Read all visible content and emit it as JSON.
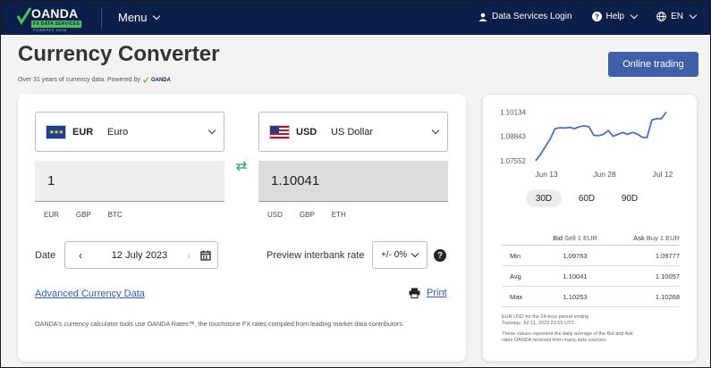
{
  "nav": {
    "brand": "OANDA",
    "brand_tag": "FX DATA SERVICES",
    "brand_sub": "POWERED DATA",
    "menu_label": "Menu",
    "login_label": "Data Services Login",
    "help_label": "Help",
    "lang_label": "EN"
  },
  "header": {
    "title": "Currency Converter",
    "subtitle": "Over 31 years of currency data. Powered by",
    "powered_brand": "OANDA",
    "cta": "Online trading"
  },
  "converter": {
    "from": {
      "code": "EUR",
      "name": "Euro",
      "amount": "1"
    },
    "to": {
      "code": "USD",
      "name": "US Dollar",
      "amount": "1.10041"
    },
    "from_quick": [
      "EUR",
      "GBP",
      "BTC"
    ],
    "to_quick": [
      "USD",
      "GBP",
      "ETH"
    ],
    "date_label": "Date",
    "date_value": "12 July 2023",
    "preview_label": "Preview interbank rate",
    "rate_value": "+/- 0%",
    "advanced_link": "Advanced Currency Data",
    "print_label": "Print",
    "disclaimer": "OANDA's currency calculator tools use OANDA Rates™, the touchstone FX rates compiled from leading market data contributors."
  },
  "chart_data": {
    "type": "line",
    "x_ticks": [
      "Jun 13",
      "Jun 28",
      "Jul 12"
    ],
    "y_ticks": [
      "1.10134",
      "1.08843",
      "1.07552"
    ],
    "ylim": [
      1.0732,
      1.1043
    ],
    "values": [
      1.0756,
      1.079,
      1.083,
      1.087,
      1.0925,
      1.093,
      1.0928,
      1.0932,
      1.0925,
      1.0935,
      1.094,
      1.0935,
      1.089,
      1.0888,
      1.0895,
      1.0915,
      1.0885,
      1.0895,
      1.0905,
      1.0895,
      1.0905,
      1.0897,
      1.088,
      1.0877,
      1.097,
      1.0978,
      1.0978,
      1.1013
    ],
    "line_color": "#4a6fc2"
  },
  "periods": [
    "30D",
    "60D",
    "90D"
  ],
  "stats": {
    "headers": [
      "",
      "Bid",
      "Sell 1 EUR",
      "Ask",
      "Buy 1 EUR"
    ],
    "rows": [
      {
        "label": "Min",
        "bid": "1.09763",
        "ask": "1.09777"
      },
      {
        "label": "Avg",
        "bid": "1.10041",
        "ask": "1.10057"
      },
      {
        "label": "Max",
        "bid": "1.10253",
        "ask": "1.10268"
      }
    ],
    "foot_line1": "EUR USD for the 24-hour period ending",
    "foot_line2": "Tuesday, Jul 11, 2023 23:59 UTC",
    "foot_line3": "These values represent the daily average of the Bid and Ask",
    "foot_line4": "rates OANDA received from many data sources."
  }
}
